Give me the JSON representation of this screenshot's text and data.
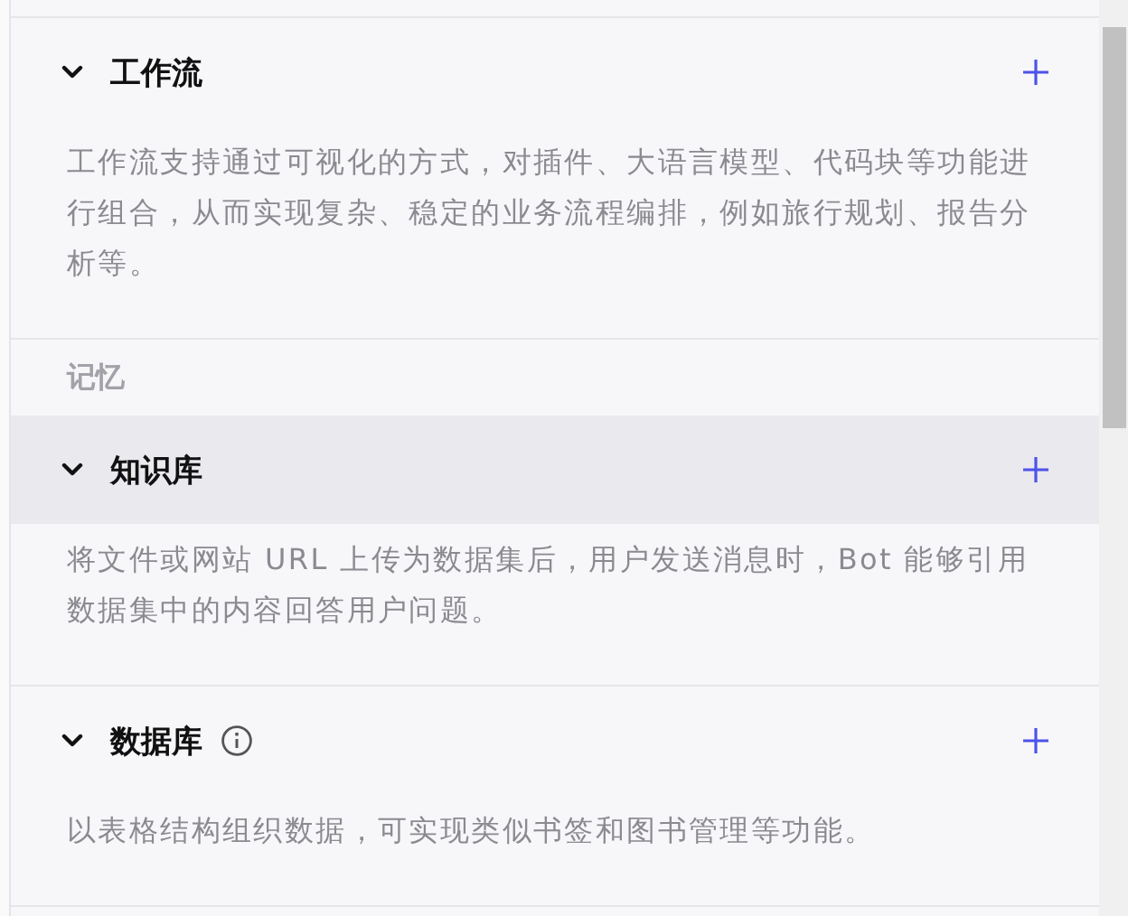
{
  "blocks": [
    {
      "kind": "section",
      "title": "工作流",
      "expanded": true,
      "highlighted": false,
      "has_info": false,
      "description": "工作流支持通过可视化的方式，对插件、大语言模型、代码块等功能进行组合，从而实现复杂、稳定的业务流程编排，例如旅行规划、报告分析等。"
    },
    {
      "kind": "group_label",
      "title": "记忆"
    },
    {
      "kind": "section",
      "title": "知识库",
      "expanded": true,
      "highlighted": true,
      "has_info": false,
      "description": "将文件或网站 URL 上传为数据集后，用户发送消息时，Bot 能够引用数据集中的内容回答用户问题。"
    },
    {
      "kind": "section",
      "title": "数据库",
      "expanded": true,
      "highlighted": false,
      "has_info": true,
      "description": "以表格结构组织数据，可实现类似书签和图书管理等功能。"
    }
  ]
}
